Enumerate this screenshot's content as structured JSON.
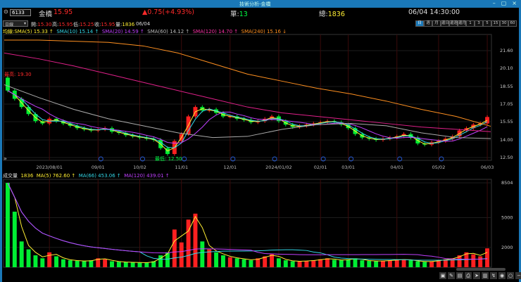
{
  "window": {
    "title": "技術分析-金橋",
    "controls": [
      "–",
      "▢",
      "×"
    ]
  },
  "quote": {
    "code": "6133",
    "name": "金橋",
    "price": "15.95",
    "change": "▲0.75(+4.93%)",
    "single_label": "單:",
    "single": "13",
    "total_label": "總:",
    "total": "1836",
    "datetime": "06/04 14:30:00"
  },
  "ohlc": {
    "period": "日線",
    "open_label": "開:",
    "open": "15.30",
    "high_label": "高:",
    "high": "15.95",
    "low_label": "低:",
    "low": "15.25",
    "close_label": "收:",
    "close": "15.95",
    "vol_label": "量:",
    "vol": "1836",
    "date": "06/04"
  },
  "period_buttons": [
    "日",
    "週",
    "月",
    "還日",
    "還週",
    "還月",
    "1",
    "3",
    "5",
    "15",
    "30",
    "60"
  ],
  "sma_legend": {
    "prefix": "均線:",
    "items": [
      "SMA(5) 15.33 ↑",
      "SMA(10) 15.14 ↑",
      "SMA(20) 14.59 ↑",
      "SMA(60) 14.12 ↑",
      "SMA(120) 14.70 ↑",
      "SMA(240) 15.16 ↓"
    ]
  },
  "vol_legend": {
    "prefix": "成交量",
    "value": "1836",
    "items": [
      "MA(5) 762.60 ↑",
      "MA(66) 453.06 ↑",
      "MA(120) 439.01 ↑"
    ]
  },
  "annotations": {
    "high": "最高: 19.30",
    "low": "最低: 12.50"
  },
  "colors": {
    "up": "#ff2020",
    "down": "#00ee33",
    "sma5": "#ffee33",
    "sma10": "#33d6e6",
    "sma20": "#c040ff",
    "sma60": "#aaaaaa",
    "sma120": "#e0208a",
    "sma240": "#ff9020",
    "grid": "#3a0a0a"
  },
  "toolbar_icons": [
    "lock-icon",
    "draw-icon",
    "window-icon",
    "print-icon",
    "cursor-icon",
    "panel-icon",
    "indicator-icon",
    "eye-icon",
    "circle-icon",
    "zoom-out-icon",
    "zoom-in-icon"
  ],
  "chart_data": {
    "type": "candlestick",
    "price_ticks": [
      "21.60",
      "20.10",
      "18.55",
      "17.05",
      "15.55",
      "14.00",
      "12.50"
    ],
    "ylim": [
      12.5,
      21.6
    ],
    "volume_ticks": [
      "8504",
      "5000",
      "2000"
    ],
    "volume_ylim": [
      0,
      8504
    ],
    "xticks": [
      {
        "label": "2023/08/01",
        "index": 6
      },
      {
        "label": "09/01",
        "index": 13
      },
      {
        "label": "10/02",
        "index": 19
      },
      {
        "label": "11/01",
        "index": 25
      },
      {
        "label": "12/01",
        "index": 32
      },
      {
        "label": "2024/01/02",
        "index": 39
      },
      {
        "label": "02/01",
        "index": 45
      },
      {
        "label": "03/01",
        "index": 49
      },
      {
        "label": "04/01",
        "index": 56
      },
      {
        "label": "05/02",
        "index": 62
      },
      {
        "label": "06/03",
        "index": 69
      }
    ],
    "close": [
      18.2,
      17.5,
      16.8,
      16.2,
      15.6,
      15.4,
      15.8,
      15.6,
      15.4,
      15.2,
      15.0,
      14.9,
      14.8,
      14.9,
      15.0,
      14.7,
      14.6,
      14.4,
      14.3,
      14.2,
      14.1,
      14.0,
      13.3,
      12.8,
      13.9,
      14.5,
      16.0,
      16.8,
      16.5,
      16.6,
      16.3,
      16.0,
      16.0,
      15.8,
      15.7,
      15.5,
      15.6,
      15.8,
      16.0,
      15.6,
      15.3,
      15.1,
      15.2,
      15.3,
      15.4,
      15.5,
      15.6,
      15.5,
      15.3,
      15.0,
      14.5,
      14.2,
      14.1,
      14.0,
      14.1,
      14.2,
      14.3,
      14.5,
      14.2,
      13.7,
      13.6,
      13.8,
      13.9,
      14.1,
      14.3,
      14.8,
      15.0,
      15.3,
      15.4,
      15.95
    ],
    "first_open": 19.3,
    "volume": [
      8504,
      5600,
      2600,
      1800,
      1200,
      900,
      1500,
      1100,
      800,
      700,
      650,
      600,
      700,
      900,
      800,
      600,
      550,
      500,
      500,
      450,
      480,
      600,
      1200,
      1500,
      3800,
      2500,
      4800,
      5400,
      2600,
      1800,
      1500,
      1200,
      1000,
      900,
      800,
      700,
      900,
      1100,
      1300,
      900,
      700,
      600,
      600,
      650,
      700,
      800,
      900,
      750,
      700,
      800,
      900,
      700,
      650,
      600,
      650,
      700,
      750,
      800,
      700,
      600,
      550,
      600,
      700,
      800,
      900,
      1200,
      1500,
      1300,
      1100,
      1900
    ],
    "sma60": [
      18.7,
      17.6,
      16.6,
      15.8,
      15.2,
      14.6,
      14.2,
      14.3,
      14.9,
      15.3,
      15.4,
      15.2,
      14.6,
      14.2,
      14.12
    ],
    "sma120": [
      21.4,
      20.9,
      20.3,
      19.6,
      18.9,
      18.2,
      17.5,
      16.8,
      16.3,
      16.0,
      15.7,
      15.4,
      15.1,
      14.9,
      14.7
    ],
    "sma240": [
      22.5,
      22.5,
      22.4,
      22.3,
      22.0,
      21.4,
      20.5,
      19.6,
      19.0,
      18.4,
      17.9,
      17.3,
      16.6,
      16.0,
      15.16
    ]
  }
}
